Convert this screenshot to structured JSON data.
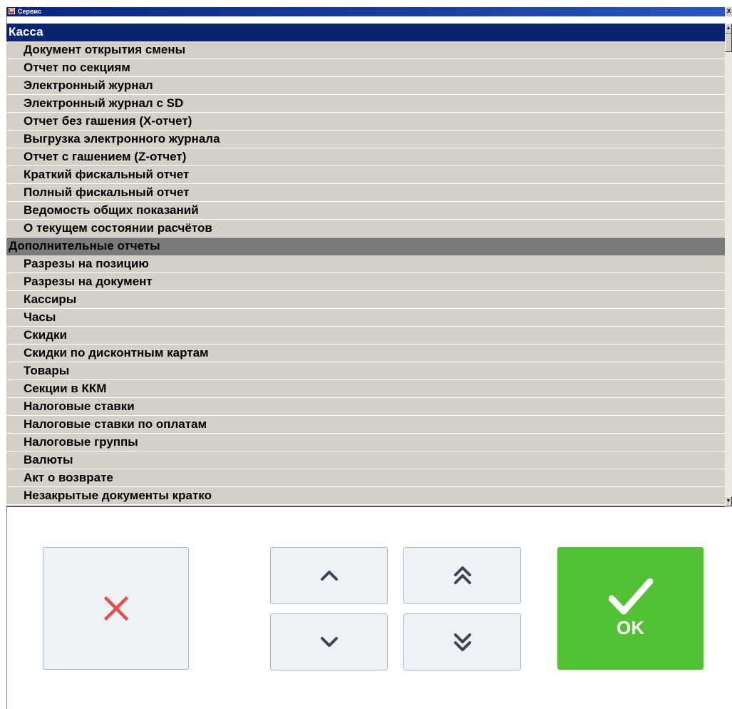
{
  "window": {
    "title": "Сервис",
    "close_glyph": "x"
  },
  "list": {
    "rows": [
      {
        "kind": "group",
        "label": "Касса",
        "selected": true
      },
      {
        "kind": "item",
        "label": "Документ открытия смены"
      },
      {
        "kind": "item",
        "label": "Отчет по секциям"
      },
      {
        "kind": "item",
        "label": "Электронный журнал"
      },
      {
        "kind": "item",
        "label": "Электронный журнал с SD"
      },
      {
        "kind": "item",
        "label": "Отчет без гашения (X-отчет)"
      },
      {
        "kind": "item",
        "label": "Выгрузка электронного журнала"
      },
      {
        "kind": "item",
        "label": "Отчет с гашением (Z-отчет)"
      },
      {
        "kind": "item",
        "label": "Краткий фискальный отчет"
      },
      {
        "kind": "item",
        "label": "Полный фискальный отчет"
      },
      {
        "kind": "item",
        "label": "Ведомость общих показаний"
      },
      {
        "kind": "item",
        "label": "О текущем состоянии расчётов"
      },
      {
        "kind": "group",
        "label": "Дополнительные отчеты",
        "selected": false
      },
      {
        "kind": "item",
        "label": "Разрезы на позицию"
      },
      {
        "kind": "item",
        "label": "Разрезы на документ"
      },
      {
        "kind": "item",
        "label": "Кассиры"
      },
      {
        "kind": "item",
        "label": "Часы"
      },
      {
        "kind": "item",
        "label": "Скидки"
      },
      {
        "kind": "item",
        "label": "Скидки по дисконтным картам"
      },
      {
        "kind": "item",
        "label": "Товары"
      },
      {
        "kind": "item",
        "label": "Секции в ККМ"
      },
      {
        "kind": "item",
        "label": "Налоговые ставки"
      },
      {
        "kind": "item",
        "label": "Налоговые ставки по оплатам"
      },
      {
        "kind": "item",
        "label": "Налоговые группы"
      },
      {
        "kind": "item",
        "label": "Валюты"
      },
      {
        "kind": "item",
        "label": "Акт о возврате"
      },
      {
        "kind": "item",
        "label": "Незакрытые документы кратко"
      }
    ]
  },
  "buttons": {
    "cancel_icon": "close-x-icon",
    "up_icon": "chevron-up-icon",
    "down_icon": "chevron-down-icon",
    "page_up_icon": "double-chevron-up-icon",
    "page_down_icon": "double-chevron-down-icon",
    "ok_icon": "checkmark-icon",
    "ok_label": "OK"
  },
  "colors": {
    "selected_group": "#0b2470",
    "group": "#7d7b79",
    "list_bg": "#d4d0c8",
    "ok_green": "#52c234",
    "cancel_red": "#e94b4b",
    "chevron": "#3a4654"
  }
}
